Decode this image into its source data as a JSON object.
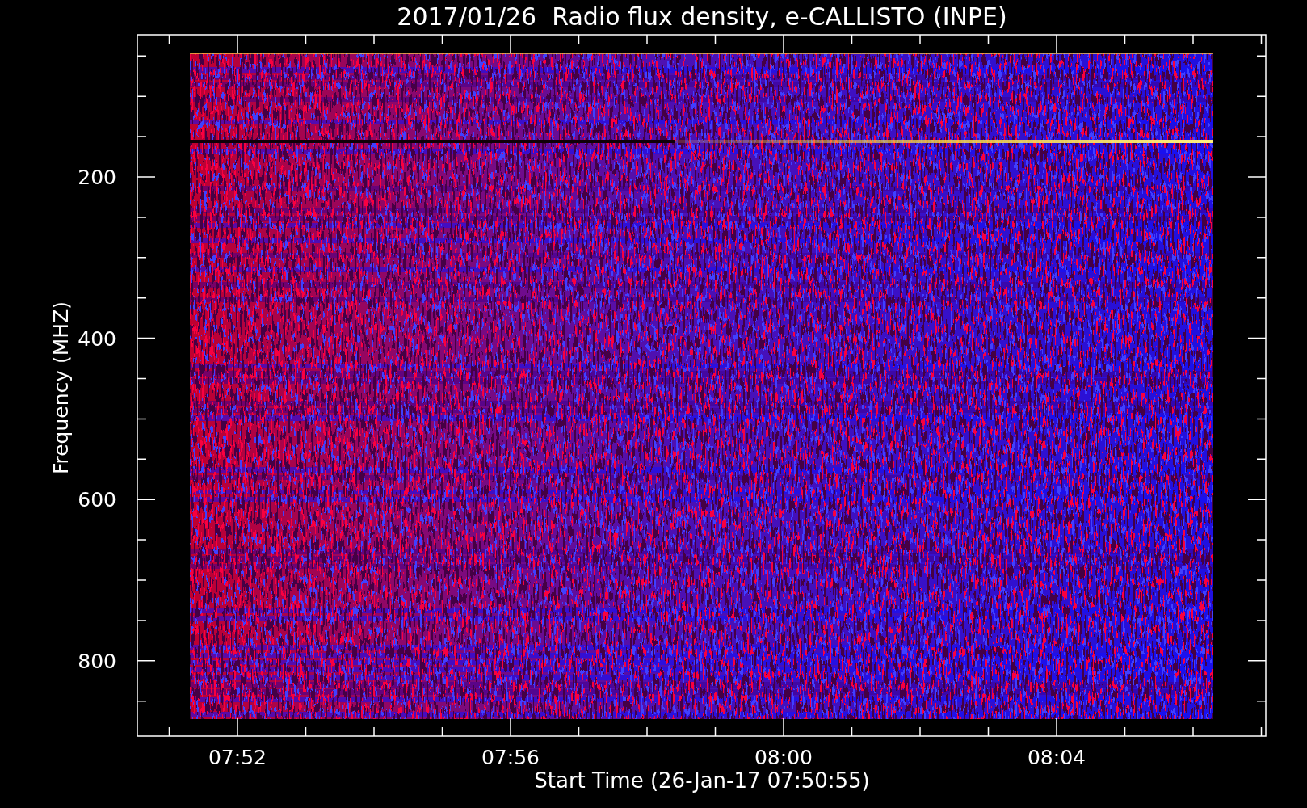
{
  "title": "2017/01/26  Radio flux density, e-CALLISTO (INPE)",
  "plot": {
    "ylabel": "Frequency (MHZ)",
    "xlabel": "Start Time (26-Jan-17 07:50:55)",
    "yticks": [
      "200",
      "400",
      "600",
      "800"
    ],
    "xticks": [
      "07:52",
      "07:56",
      "08:00",
      "08:04"
    ]
  }
}
